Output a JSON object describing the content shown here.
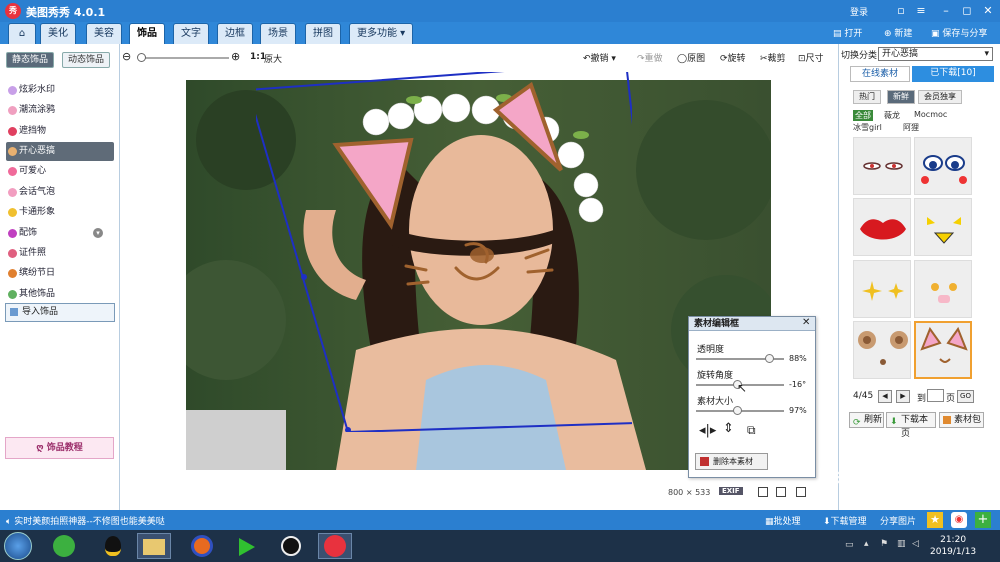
{
  "app": {
    "title": "美图秀秀 4.0.1",
    "logo_text": "秀",
    "login": "登录"
  },
  "menu": {
    "tabs": [
      "美化",
      "美容",
      "饰品",
      "文字",
      "边框",
      "场景",
      "拼图",
      "更多功能 ▾"
    ],
    "active_tab": "饰品",
    "actions": [
      "打开",
      "新建",
      "保存与分享"
    ]
  },
  "left_panel": {
    "subtabs": [
      "静态饰品",
      "动态饰品"
    ],
    "categories": [
      "炫彩水印",
      "潮流涂鸦",
      "遮挡物",
      "开心恶搞",
      "可爱心",
      "会话气泡",
      "卡通形象",
      "配饰",
      "证件照",
      "缤纷节日",
      "其他饰品"
    ],
    "active_category": "开心恶搞",
    "import_button": "导入饰品",
    "tutorial_button": "饰品教程"
  },
  "toolbar": {
    "zoom_one": "1:1",
    "zoom_original": "原大",
    "undo": "撤销",
    "redo": "重做",
    "original": "原图",
    "rotate": "旋转",
    "crop": "裁剪",
    "resize": "尺寸"
  },
  "canvas": {
    "size_width": "800",
    "size_x": "×",
    "size_height": "533",
    "exif_label": "EXIF"
  },
  "editor": {
    "title": "素材编辑框",
    "opacity_label": "透明度",
    "opacity_value": "88%",
    "opacity": 0.88,
    "rotation_label": "旋转角度",
    "rotation_value": "-16°",
    "size_label": "素材大小",
    "size_value": "97%",
    "delete_button": "删除本素材"
  },
  "right_panel": {
    "switch_label": "切换分类",
    "selected_category": "开心恶搞",
    "tabs": [
      "在线素材",
      "已下载[10]"
    ],
    "pills": [
      "热门",
      "新鲜",
      "会员独享"
    ],
    "active_pill": "新鲜",
    "subfilters_row1": [
      "全部",
      "薇龙",
      "Mocmoc"
    ],
    "subfilters_row2": [
      "冰雪girl",
      "阿狸"
    ],
    "pager_text": "4/45",
    "goto_label": "到",
    "page_label": "页",
    "go_button": "GO",
    "buttons": [
      "刷新",
      "下载本页",
      "素材包"
    ]
  },
  "status_bar": {
    "marquee": "实时美颜拍照神器--不修图也能美美哒",
    "batch": "批处理",
    "download_manager": "下载管理",
    "share_image": "分享图片"
  },
  "taskbar": {
    "time": "21:20",
    "date": "2019/1/13"
  },
  "watermark": "Bai 经验",
  "watermark_url": "jingyan.baidu.com",
  "colors": {
    "title_blue": "#2b7fd0",
    "accent_pink": "#f4a6c7",
    "frame_blue": "#1e2fc4"
  }
}
